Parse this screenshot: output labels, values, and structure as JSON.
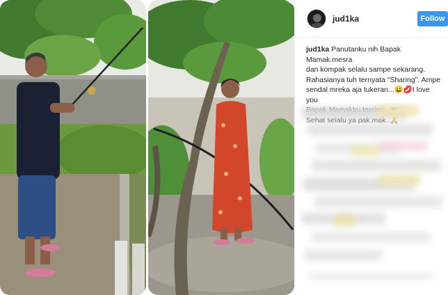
{
  "profile": {
    "username": "jud1ka",
    "avatar_icon": "profile-avatar-icon",
    "follow_label": "Follow",
    "follow_color": "#3897f0"
  },
  "caption": {
    "username": "jud1ka",
    "line1": "Panutanku nih Bapak Mamak.mesra",
    "line2": "dan kompak selalu sampe sekarang.",
    "line3": "Rahasianya tuh ternyata \"Sharing\". Ampe",
    "line4": "sendal mreka aja tukeran...😀💋I love you",
    "line5": "Bapak Mamakku tercinta..❤",
    "line6": "Sehat selalu ya pak.mak..🙏"
  },
  "photo": {
    "left_panel": "photo-man-fishing-rod",
    "right_panel": "photo-woman-under-tree"
  }
}
